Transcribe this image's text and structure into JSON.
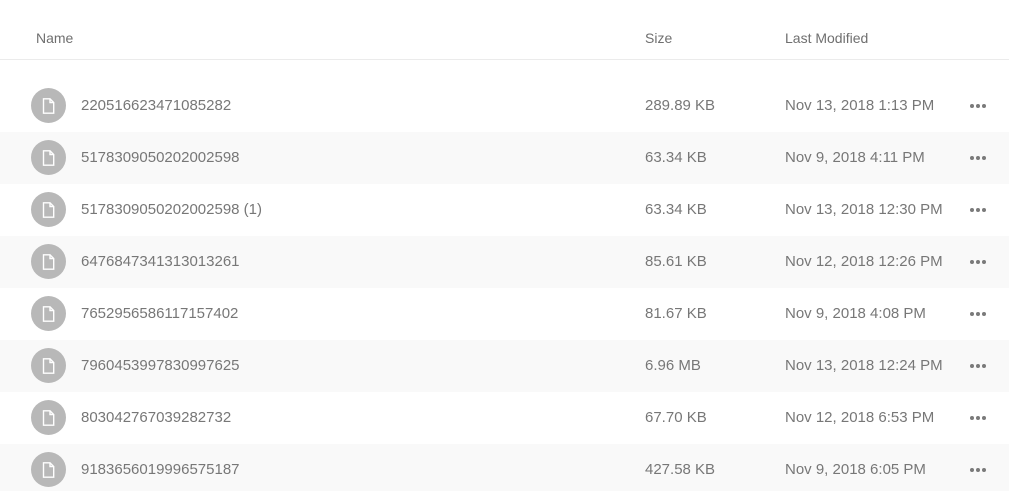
{
  "columns": {
    "name": "Name",
    "size": "Size",
    "modified": "Last Modified"
  },
  "icons": {
    "file": "file-icon",
    "more": "more-options-icon"
  },
  "colors": {
    "icon_bg": "#b8b8b8",
    "text": "#777777",
    "header_text": "#6f6f6f",
    "alt_row": "#f9f9f9"
  },
  "files": [
    {
      "name": "220516623471085282",
      "size": "289.89 KB",
      "modified": "Nov 13, 2018 1:13 PM"
    },
    {
      "name": "5178309050202002598",
      "size": "63.34 KB",
      "modified": "Nov 9, 2018 4:11 PM"
    },
    {
      "name": "5178309050202002598 (1)",
      "size": "63.34 KB",
      "modified": "Nov 13, 2018 12:30 PM"
    },
    {
      "name": "6476847341313013261",
      "size": "85.61 KB",
      "modified": "Nov 12, 2018 12:26 PM"
    },
    {
      "name": "7652956586117157402",
      "size": "81.67 KB",
      "modified": "Nov 9, 2018 4:08 PM"
    },
    {
      "name": "7960453997830997625",
      "size": "6.96 MB",
      "modified": "Nov 13, 2018 12:24 PM"
    },
    {
      "name": "803042767039282732",
      "size": "67.70 KB",
      "modified": "Nov 12, 2018 6:53 PM"
    },
    {
      "name": "9183656019996575187",
      "size": "427.58 KB",
      "modified": "Nov 9, 2018 6:05 PM"
    }
  ]
}
